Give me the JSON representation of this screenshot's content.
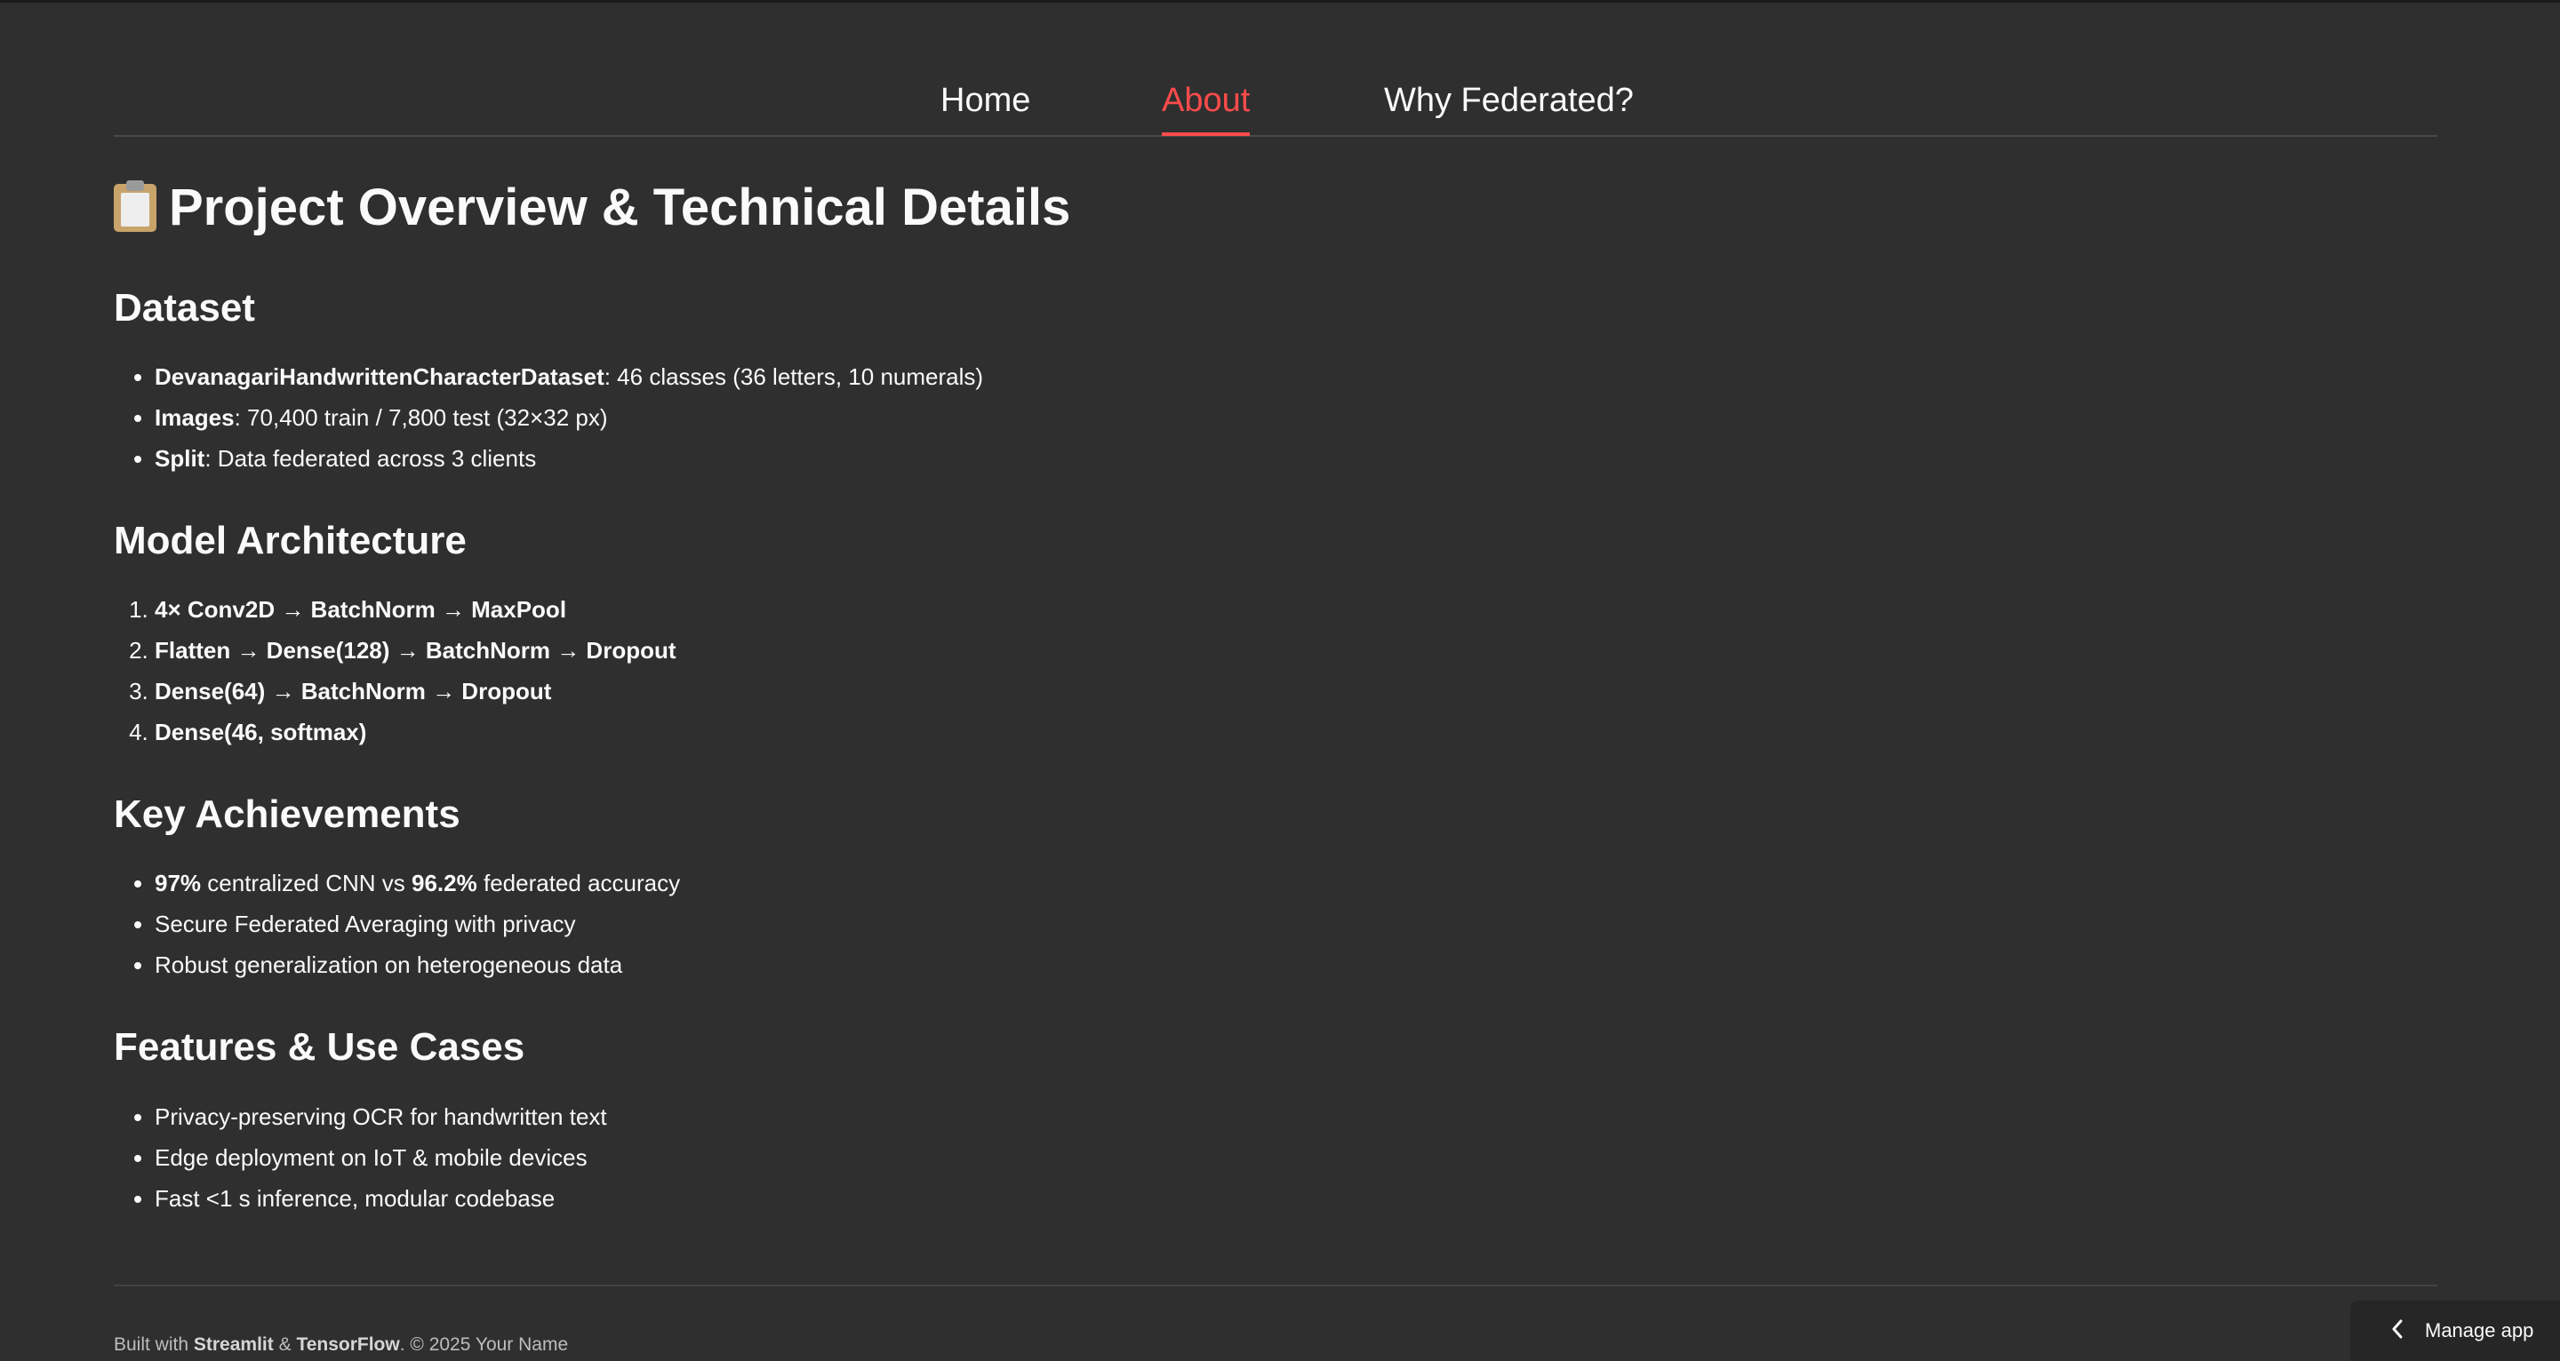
{
  "tabs": [
    {
      "label": "Home"
    },
    {
      "label": "About"
    },
    {
      "label": "Why Federated?"
    }
  ],
  "active_tab": "About",
  "accent_color": "#ff4b4b",
  "page_title": "Project Overview & Technical Details",
  "page_title_icon": "clipboard-icon",
  "dataset": {
    "heading": "Dataset",
    "items": [
      {
        "bold": "DevanagariHandwrittenCharacterDataset",
        "text": ": 46 classes (36 letters, 10 numerals)"
      },
      {
        "bold": "Images",
        "text": ": 70,400 train / 7,800 test (32×32 px)"
      },
      {
        "bold": "Split",
        "text": ": Data federated across 3 clients"
      }
    ]
  },
  "architecture": {
    "heading": "Model Architecture",
    "items": [
      "4× Conv2D → BatchNorm → MaxPool",
      "Flatten → Dense(128) → BatchNorm → Dropout",
      "Dense(64) → BatchNorm → Dropout",
      "Dense(46, softmax)"
    ]
  },
  "achievements": {
    "heading": "Key Achievements",
    "first": {
      "bold1": "97%",
      "mid": " centralized CNN vs ",
      "bold2": "96.2%",
      "end": " federated accuracy"
    },
    "items": [
      "Secure Federated Averaging with privacy",
      "Robust generalization on heterogeneous data"
    ]
  },
  "features": {
    "heading": "Features & Use Cases",
    "items": [
      "Privacy-preserving OCR for handwritten text",
      "Edge deployment on IoT & mobile devices",
      "Fast <1 s inference, modular codebase"
    ]
  },
  "footer": {
    "prefix": "Built with ",
    "tool1": "Streamlit",
    "amp": " & ",
    "tool2": "TensorFlow",
    "suffix": ". © 2025 Your Name"
  },
  "manage_app": {
    "label": "Manage app",
    "icon": "chevron-left-icon"
  }
}
